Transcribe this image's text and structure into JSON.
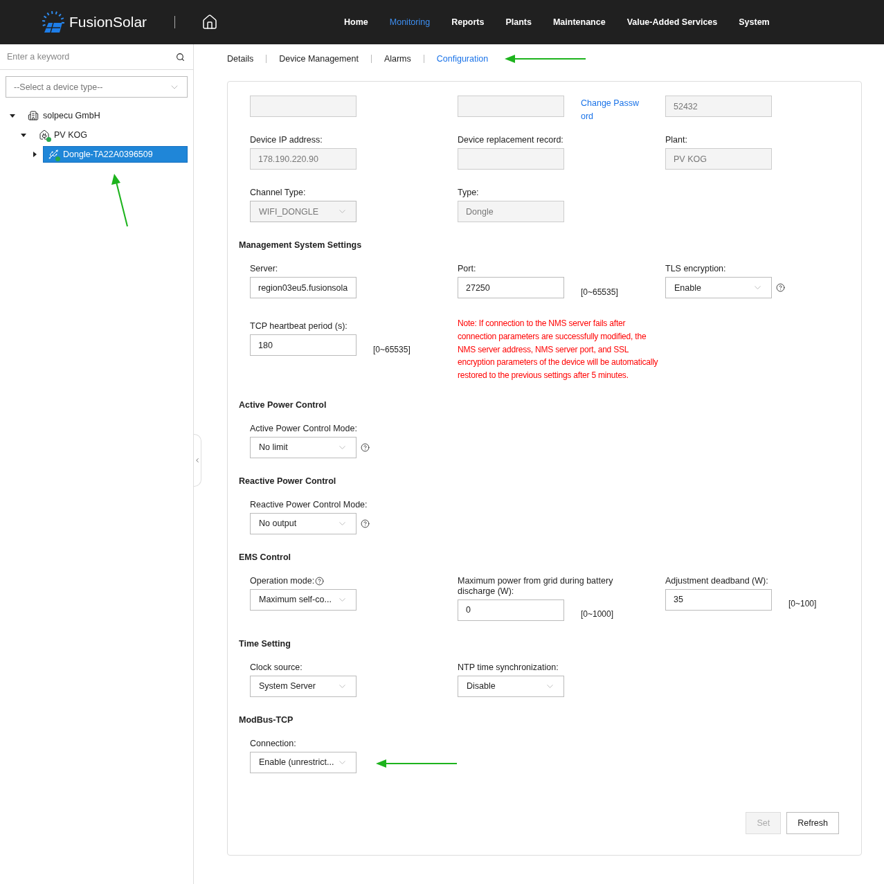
{
  "header": {
    "brand": "FusionSolar",
    "nav": [
      {
        "label": "Home",
        "selected": false
      },
      {
        "label": "Monitoring",
        "selected": true
      },
      {
        "label": "Reports",
        "selected": false
      },
      {
        "label": "Plants",
        "selected": false
      },
      {
        "label": "Maintenance",
        "selected": false
      },
      {
        "label": "Value-Added Services",
        "selected": false
      },
      {
        "label": "System",
        "selected": false
      }
    ]
  },
  "sidebar": {
    "search": {
      "placeholder": "Enter a keyword"
    },
    "device_type": {
      "placeholder": "--Select a device type--"
    },
    "tree": [
      {
        "label": "solpecu GmbH",
        "kind": "company",
        "expanded": true,
        "selected": false,
        "online": false,
        "children": [
          {
            "label": "PV KOG",
            "kind": "plant",
            "expanded": true,
            "selected": false,
            "online": true,
            "children": [
              {
                "label": "Dongle-TA22A0396509",
                "kind": "dongle",
                "expanded": false,
                "selected": true,
                "online": true
              }
            ]
          }
        ]
      }
    ]
  },
  "tabs": [
    {
      "label": "Details",
      "selected": false
    },
    {
      "label": "Device Management",
      "selected": false
    },
    {
      "label": "Alarms",
      "selected": false
    },
    {
      "label": "Configuration",
      "selected": true
    }
  ],
  "sections": [
    {
      "rows": [
        [
          {
            "kind": "readonly"
          },
          {
            "kind": "readonly",
            "link": "Change Password"
          },
          {
            "kind": "readonly",
            "value": "52432"
          }
        ],
        [
          {
            "kind": "readonly",
            "label": "Device IP address:",
            "value": "178.190.220.90"
          },
          {
            "kind": "readonly",
            "label": "Device replacement record:"
          },
          {
            "kind": "readonly",
            "label": "Plant:",
            "value": "PV KOG"
          }
        ],
        [
          {
            "kind": "select",
            "label": "Channel Type:",
            "disabled": true,
            "value": "WIFI_DONGLE"
          },
          {
            "kind": "readonly",
            "label": "Type:",
            "value": "Dongle"
          }
        ]
      ]
    },
    {
      "title": "Management System Settings",
      "rows": [
        [
          {
            "kind": "input",
            "label": "Server:",
            "value": "region03eu5.fusionsola"
          },
          {
            "kind": "input",
            "label": "Port:",
            "value": "27250",
            "range": "[0~65535]"
          },
          {
            "kind": "select",
            "label": "TLS encryption:",
            "disabled": false,
            "value": "Enable",
            "help": true
          }
        ],
        [
          {
            "kind": "input",
            "label": "TCP heartbeat period (s):",
            "value": "180",
            "range": "[0~65535]"
          },
          {
            "kind": "note",
            "text": "Note: If connection to the NMS server fails after connection parameters are successfully modified, the NMS server address, NMS server port, and SSL encryption parameters of the device will be automatically restored to the previous settings after 5 minutes."
          }
        ]
      ]
    },
    {
      "title": "Active Power Control",
      "rows": [
        [
          {
            "kind": "select",
            "label": "Active Power Control Mode:",
            "disabled": false,
            "value": "No limit",
            "help": true
          }
        ]
      ]
    },
    {
      "title": "Reactive Power Control",
      "rows": [
        [
          {
            "kind": "select",
            "label": "Reactive Power Control Mode:",
            "disabled": false,
            "value": "No output",
            "help": true
          }
        ]
      ]
    },
    {
      "title": "EMS Control",
      "rows": [
        [
          {
            "kind": "select",
            "label": "Operation mode:",
            "label_help": true,
            "disabled": false,
            "value": "Maximum self-co..."
          },
          {
            "kind": "input",
            "label": "Maximum power from grid during battery discharge (W):",
            "value": "0",
            "range": "[0~1000]"
          },
          {
            "kind": "input",
            "label": "Adjustment deadband (W):",
            "value": "35",
            "range": "[0~100]"
          }
        ]
      ]
    },
    {
      "title": "Time Setting",
      "rows": [
        [
          {
            "kind": "select",
            "label": "Clock source:",
            "disabled": false,
            "value": "System Server"
          },
          {
            "kind": "select",
            "label": "NTP time synchronization:",
            "disabled": false,
            "value": "Disable"
          }
        ]
      ]
    },
    {
      "title": "ModBus-TCP",
      "rows": [
        [
          {
            "kind": "select",
            "label": "Connection:",
            "disabled": false,
            "value": "Enable (unrestrict..."
          },
          {
            "kind": "arrow"
          }
        ]
      ]
    }
  ],
  "actions": [
    {
      "label": "Set",
      "disabled": true
    },
    {
      "label": "Refresh",
      "disabled": false
    }
  ]
}
